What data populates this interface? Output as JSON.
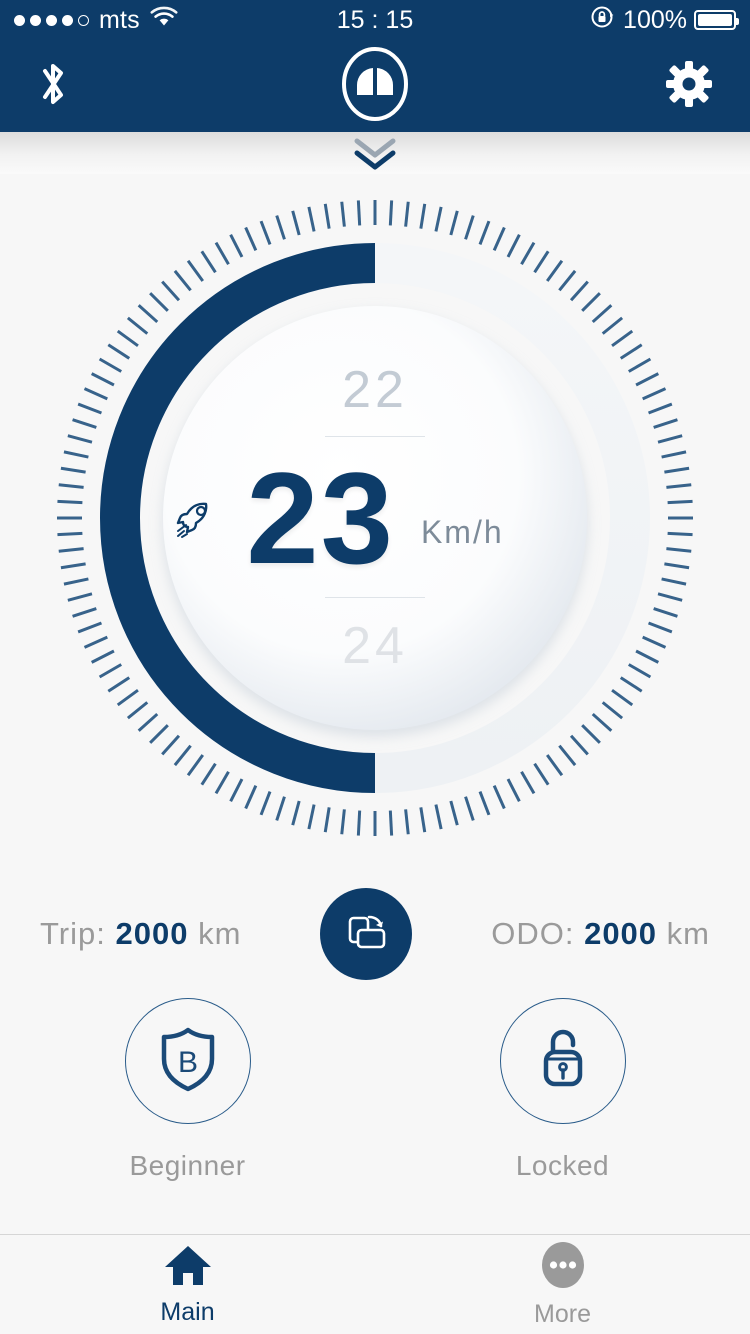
{
  "status_bar": {
    "carrier": "mts",
    "signal_dots_filled": 4,
    "signal_dots_total": 5,
    "wifi_icon": "wifi-icon",
    "time": "15 : 15",
    "rotation_lock_icon": "rotation-lock-icon",
    "battery_percent": "100%",
    "battery_icon": "battery-full-icon"
  },
  "app_header": {
    "bluetooth_icon": "bluetooth-icon",
    "logo_icon": "brand-logo-icon",
    "settings_icon": "gear-icon",
    "background_color": "#0d3c69"
  },
  "pull_handle": {
    "icon": "double-chevron-down-icon"
  },
  "gauge": {
    "previous_value": "22",
    "current_value": "23",
    "next_value": "24",
    "unit": "Km/h",
    "speed_icon": "rocket-icon",
    "arc_fill_color": "#0d3c69",
    "arc_track_color": "#f2f4f6",
    "tick_color": "#2e5c86",
    "arc_percent": 50
  },
  "stats": {
    "trip": {
      "label": "Trip:",
      "value": "2000",
      "unit": "km"
    },
    "odo": {
      "label": "ODO:",
      "value": "2000",
      "unit": "km"
    },
    "reset_icon": "screen-rotate-icon"
  },
  "modes": [
    {
      "icon": "shield-b-icon",
      "label": "Beginner"
    },
    {
      "icon": "padlock-unlocked-icon",
      "label": "Locked"
    }
  ],
  "tabs": [
    {
      "icon": "home-icon",
      "label": "Main",
      "active": true
    },
    {
      "icon": "ellipsis-circle-icon",
      "label": "More",
      "active": false
    }
  ],
  "colors": {
    "navy": "#0d3c69",
    "gray_text": "#9a9a9a",
    "page_bg": "#f7f7f7"
  },
  "chart_data": {
    "type": "gauge",
    "title": "Speedometer",
    "value": 23,
    "unit": "Km/h",
    "neighbors": [
      22,
      24
    ],
    "arc_percent": 50,
    "arc_start_deg": 0,
    "arc_sweep_deg": 180,
    "tick_count": 120
  }
}
